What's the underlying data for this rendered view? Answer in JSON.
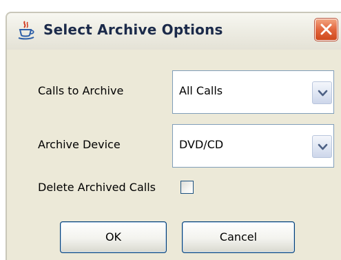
{
  "dialog": {
    "title": "Select Archive Options",
    "title_icon": "java-coffee-cup-icon",
    "close_icon": "close-icon"
  },
  "fields": {
    "calls_to_archive": {
      "label": "Calls to Archive",
      "value": "All Calls"
    },
    "archive_device": {
      "label": "Archive Device",
      "value": "DVD/CD"
    },
    "delete_archived_calls": {
      "label": "Delete Archived Calls",
      "checked": false
    }
  },
  "buttons": {
    "ok_label": "OK",
    "cancel_label": "Cancel"
  },
  "colors": {
    "close_button": "#e2663d",
    "panel_background": "#ece9d8",
    "input_border": "#7f9db9",
    "button_border": "#003c74"
  }
}
